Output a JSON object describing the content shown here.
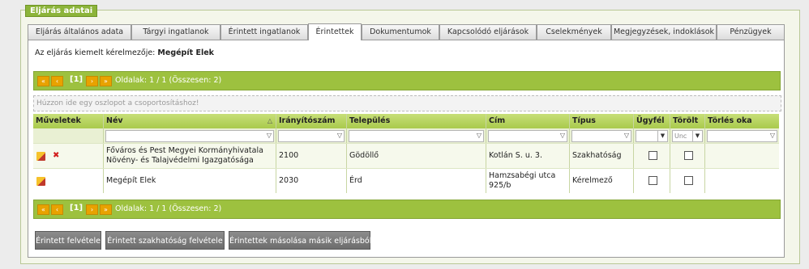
{
  "panel": {
    "title": "Eljárás adatai"
  },
  "tabs": [
    {
      "label": "Eljárás általános adata"
    },
    {
      "label": "Tárgyi ingatlanok"
    },
    {
      "label": "Érintett ingatlanok"
    },
    {
      "label": "Érintettek",
      "active": true
    },
    {
      "label": "Dokumentumok"
    },
    {
      "label": "Kapcsolódó eljárások"
    },
    {
      "label": "Cselekmények"
    },
    {
      "label": "Megjegyzések, indoklások"
    },
    {
      "label": "Pénzügyek"
    }
  ],
  "requester": {
    "label": "Az eljárás kiemelt kérelmezője:",
    "name": "Megépít Elek"
  },
  "pager_top": {
    "first": "«",
    "prev": "‹",
    "current": "[1]",
    "next": "›",
    "last": "»",
    "info": "Oldalak: 1 / 1 (Összesen: 2)"
  },
  "pager_bottom": {
    "first": "«",
    "prev": "‹",
    "current": "[1]",
    "next": "›",
    "last": "»",
    "info": "Oldalak: 1 / 1 (Összesen: 2)"
  },
  "group_area": "Húzzon ide egy oszlopot a csoportosításhoz!",
  "columns": {
    "actions": "Műveletek",
    "name": "Név",
    "zip": "Irányítószám",
    "city": "Település",
    "address": "Cím",
    "type": "Típus",
    "client": "Ügyfél",
    "deleted": "Törölt",
    "delete_reason": "Törlés oka"
  },
  "filters": {
    "deleted_select": "Unc"
  },
  "rows": [
    {
      "name": "Főváros és Pest Megyei Kormányhivatala Növény- és Talajvédelmi Igazgatósága",
      "zip": "2100",
      "city": "Gödöllő",
      "address": "Kotlán S. u. 3.",
      "type": "Szakhatóság",
      "client": false,
      "deleted": false,
      "delete_reason": ""
    },
    {
      "name": "Megépít Elek",
      "zip": "2030",
      "city": "Érd",
      "address": "Hamzsabégi utca 925/b",
      "type": "Kérelmező",
      "client": false,
      "deleted": false,
      "delete_reason": ""
    }
  ],
  "buttons": {
    "add_affected": "Érintett felvétele",
    "add_authority": "Érintett szakhatóság felvétele",
    "copy_affected": "Érintettek másolása másik eljárásból"
  },
  "colors": {
    "accent_green": "#9dc13f",
    "header_green": "#b5d35e",
    "pager_btn": "#e8a200",
    "button_grey": "#7a7a7a"
  }
}
